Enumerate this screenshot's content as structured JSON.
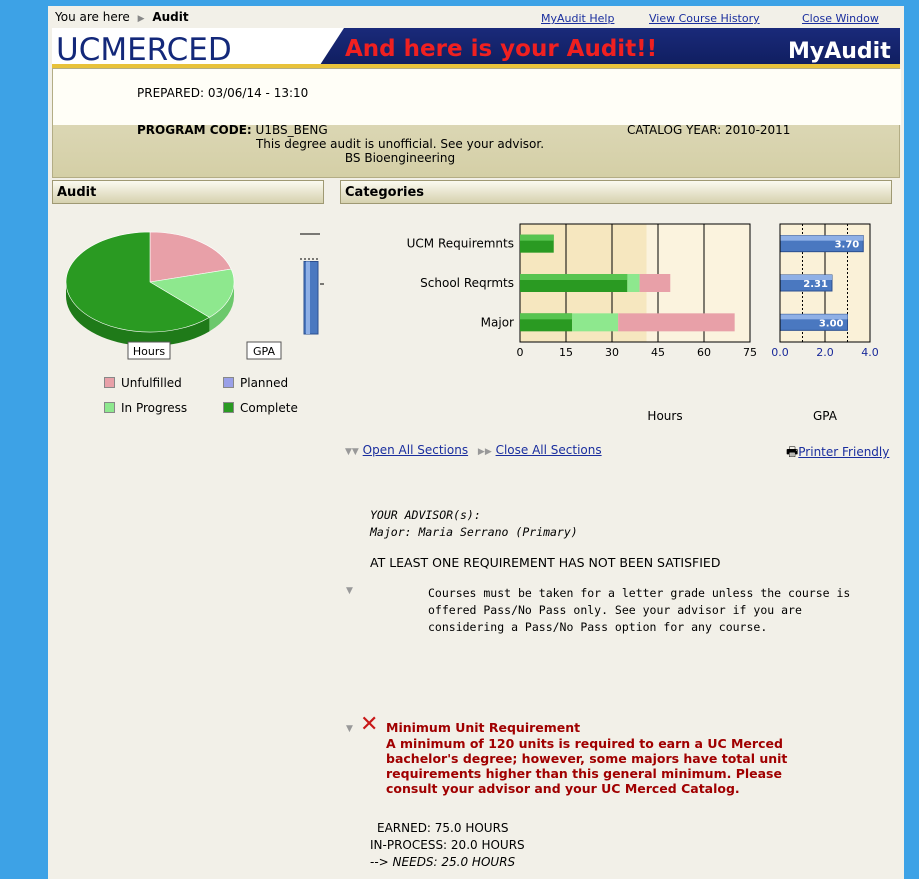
{
  "topbar": {
    "breadcrumb_prefix": "You are here",
    "breadcrumb_current": "Audit",
    "links": [
      "MyAudit Help",
      "View Course History",
      "Close Window"
    ]
  },
  "banner": {
    "logo": "UCMERCED",
    "headline": "And here is your Audit!!",
    "brand": "MyAudit"
  },
  "header": {
    "prepared": "PREPARED: 03/06/14 - 13:10",
    "program_code_label": "PROGRAM CODE:",
    "program_code": "U1BS_BENG",
    "catalog_year": "CATALOG YEAR: 2010-2011",
    "notice": "This degree audit is unofficial. See your advisor.",
    "degree": "BS Bioengineering"
  },
  "sections": {
    "audit": "Audit",
    "categories": "Categories"
  },
  "audit_panel": {
    "gpa_ticks": [
      "4.0",
      "2.0",
      "0.0"
    ],
    "hours_label": "Hours",
    "gpa_label": "GPA",
    "legend": [
      {
        "label": "Unfulfilled",
        "color": "#e8a0a8"
      },
      {
        "label": "Planned",
        "color": "#9aa0e8"
      },
      {
        "label": "In Progress",
        "color": "#8ee88e"
      },
      {
        "label": "Complete",
        "color": "#2a9a22"
      }
    ]
  },
  "colors": {
    "complete": "#2a9a22",
    "in_progress": "#8ee88e",
    "unfulfilled": "#e8a0a8",
    "planned": "#9aa0e8",
    "gpa_bar": "#4a78c0",
    "error_red": "#a00000"
  },
  "chart_data": [
    {
      "type": "pie",
      "labels": [
        "Complete",
        "In Progress",
        "Unfulfilled"
      ],
      "values": [
        75,
        20,
        25
      ],
      "xlabel": "Hours"
    },
    {
      "type": "bar",
      "ylim": [
        0,
        4.0
      ],
      "values": [
        2.9
      ],
      "xlabel": "GPA"
    },
    {
      "type": "bar",
      "orientation": "horizontal",
      "stacked": true,
      "categories": [
        "UCM Requiremnts",
        "School Reqrmts",
        "Major"
      ],
      "series": [
        {
          "name": "Complete",
          "values": [
            11,
            35,
            17
          ]
        },
        {
          "name": "In Progress",
          "values": [
            0,
            4,
            15
          ]
        },
        {
          "name": "Unfulfilled",
          "values": [
            0,
            10,
            38
          ]
        }
      ],
      "xlim": [
        0,
        75
      ],
      "xticks": [
        "0",
        "15",
        "30",
        "45",
        "60",
        "75"
      ],
      "xlabel": "Hours"
    },
    {
      "type": "bar",
      "orientation": "horizontal",
      "categories": [
        "UCM Requiremnts",
        "School Reqrmts",
        "Major"
      ],
      "values": [
        3.7,
        2.31,
        3.0
      ],
      "labels": [
        "3.70",
        "2.31",
        "3.00"
      ],
      "xlim": [
        0,
        4.0
      ],
      "xticks": [
        "0.0",
        "2.0",
        "4.0"
      ],
      "xlabel": "GPA"
    }
  ],
  "controls": {
    "open_all": "Open All Sections",
    "close_all": "Close All Sections",
    "printer": "Printer Friendly"
  },
  "body": {
    "advisor_heading": "YOUR ADVISOR(s):",
    "advisor_line": "Major: Maria Serrano (Primary)",
    "status": "AT LEAST ONE REQUIREMENT HAS NOT BEEN SATISFIED",
    "note_lines": [
      "Courses must be taken for a letter grade unless the course is",
      "offered Pass/No Pass only.  See your advisor if you are",
      "considering a Pass/No Pass option for any course."
    ],
    "req_title": "Minimum Unit Requirement",
    "req_lines": [
      "A minimum of 120 units is required to earn a UC Merced",
      "bachelor's degree; however, some majors have total unit",
      "requirements higher than this general minimum. Please",
      "consult your advisor and your UC Merced Catalog."
    ],
    "earned": "EARNED: 75.0 HOURS",
    "in_process": "IN-PROCESS: 20.0 HOURS",
    "needs_prefix": "-->",
    "needs": "NEEDS:  25.0 HOURS"
  }
}
